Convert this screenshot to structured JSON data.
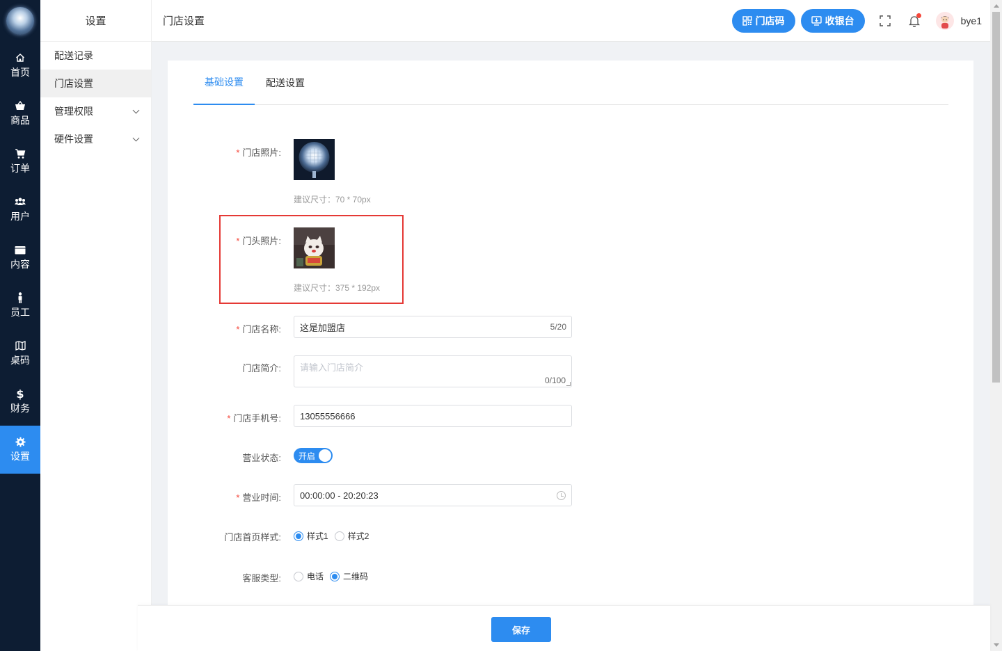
{
  "nav": {
    "items": [
      {
        "label": "首页",
        "icon": "home-icon"
      },
      {
        "label": "商品",
        "icon": "basket-icon"
      },
      {
        "label": "订单",
        "icon": "cart-icon"
      },
      {
        "label": "用户",
        "icon": "users-icon"
      },
      {
        "label": "内容",
        "icon": "folder-icon"
      },
      {
        "label": "员工",
        "icon": "person-icon"
      },
      {
        "label": "桌码",
        "icon": "map-icon"
      },
      {
        "label": "财务",
        "icon": "dollar-icon"
      },
      {
        "label": "设置",
        "icon": "gear-icon"
      }
    ],
    "active": "设置",
    "accent": "#2d8cf0",
    "background": "#0d1d33"
  },
  "submenu": {
    "title": "设置",
    "items": [
      {
        "label": "配送记录"
      },
      {
        "label": "门店设置"
      },
      {
        "label": "管理权限"
      },
      {
        "label": "硬件设置"
      }
    ]
  },
  "header": {
    "breadcrumb": "门店设置",
    "store_code_button": "门店码",
    "cashier_button": "收银台",
    "username": "bye1"
  },
  "tabs": [
    "基础设置",
    "配送设置"
  ],
  "form": {
    "store_photo": {
      "label": "门店照片:",
      "hint": "建议尺寸：70 * 70px"
    },
    "door_photo": {
      "label": "门头照片:",
      "hint": "建议尺寸：375 * 192px"
    },
    "store_name": {
      "label": "门店名称:",
      "value": "这是加盟店",
      "count": "5/20"
    },
    "store_intro": {
      "label": "门店简介:",
      "placeholder": "请输入门店简介",
      "count": "0/100"
    },
    "store_phone": {
      "label": "门店手机号:",
      "value": "13055556666"
    },
    "business_status": {
      "label": "营业状态:",
      "switch_text": "开启"
    },
    "business_hours": {
      "label": "营业时间:",
      "value": "00:00:00 - 20:20:23"
    },
    "home_style": {
      "label": "门店首页样式:",
      "options": [
        "样式1",
        "样式2"
      ],
      "selected": "样式1"
    },
    "service_type": {
      "label": "客服类型:",
      "options": [
        "电话",
        "二维码"
      ],
      "selected": "二维码"
    }
  },
  "footer": {
    "save_button": "保存"
  },
  "colors": {
    "primary": "#2d8cf0",
    "required": "#f5463a",
    "highlight_border": "#e53935"
  }
}
